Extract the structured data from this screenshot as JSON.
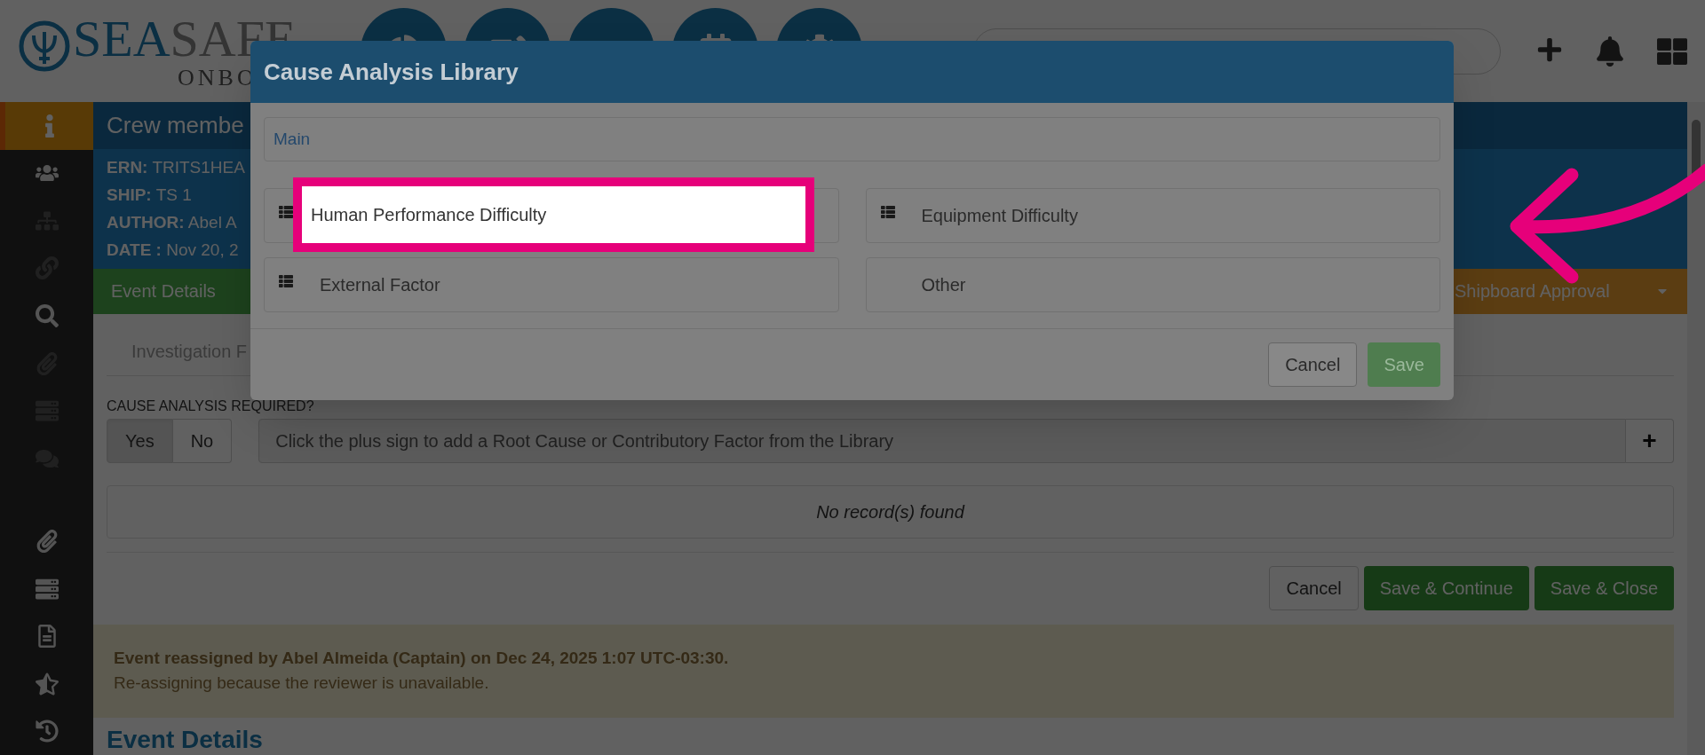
{
  "logo": {
    "primary": "SEA",
    "secondary": "SAFE",
    "tagline": "ONBO"
  },
  "sidebar": {
    "items": [
      {
        "selected": true,
        "disabled": false
      },
      {
        "selected": false,
        "disabled": false
      },
      {
        "selected": false,
        "disabled": true
      },
      {
        "selected": false,
        "disabled": true
      },
      {
        "selected": false,
        "disabled": false
      },
      {
        "selected": false,
        "disabled": true
      },
      {
        "selected": false,
        "disabled": true
      },
      {
        "selected": false,
        "disabled": true
      },
      {
        "selected": false,
        "disabled": false
      },
      {
        "selected": false,
        "disabled": false
      },
      {
        "selected": false,
        "disabled": false
      },
      {
        "selected": false,
        "disabled": false
      },
      {
        "selected": false,
        "disabled": false
      }
    ]
  },
  "record": {
    "title": "Crew membe",
    "fields": [
      {
        "label": "ERN:",
        "value": "TRITS1HEA"
      },
      {
        "label": "SHIP:",
        "value": "TS 1"
      },
      {
        "label": "AUTHOR:",
        "value": "Abel A"
      },
      {
        "label": "DATE :",
        "value": "Nov 20, 2"
      }
    ]
  },
  "workflow": [
    {
      "label": "Event Details",
      "kind": "done"
    },
    {
      "label": "Shipboard Approval",
      "kind": "current"
    }
  ],
  "tabs": [
    {
      "label": "Investigation F",
      "selected": false
    }
  ],
  "cause_analysis": {
    "label": "CAUSE ANALYSIS REQUIRED?",
    "options": [
      {
        "label": "Yes",
        "selected": true
      },
      {
        "label": "No",
        "selected": false
      }
    ],
    "placeholder": "Click the plus sign to add a Root Cause or Contributory Factor from the Library",
    "add_button": "+"
  },
  "empty_message": "No record(s) found",
  "form_buttons": [
    {
      "label": "Cancel",
      "kind": "default"
    },
    {
      "label": "Save & Continue",
      "kind": "primary"
    },
    {
      "label": "Save & Close",
      "kind": "primary"
    }
  ],
  "alert": {
    "title": "Event reassigned by Abel Almeida (Captain) on Dec 24, 2025 1:07 UTC-03:30.",
    "message": "Re-assigning because the reviewer is unavailable."
  },
  "section_heading": "Event Details",
  "modal": {
    "title": "Cause Analysis Library",
    "breadcrumb": "Main",
    "items": [
      {
        "label": "Human Performance Difficulty",
        "has_children": true,
        "highlighted": true
      },
      {
        "label": "Equipment Difficulty",
        "has_children": true,
        "highlighted": false
      },
      {
        "label": "External Factor",
        "has_children": true,
        "highlighted": false
      },
      {
        "label": "Other",
        "has_children": false,
        "highlighted": false
      }
    ],
    "buttons": [
      {
        "label": "Cancel",
        "kind": "default"
      },
      {
        "label": "Save",
        "kind": "primary",
        "disabled": true
      }
    ]
  }
}
